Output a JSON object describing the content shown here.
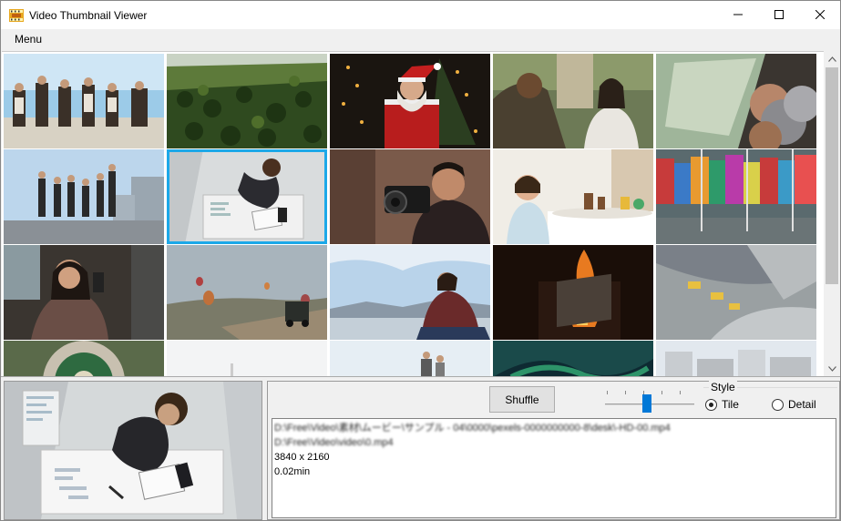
{
  "window": {
    "title": "Video Thumbnail Viewer",
    "controls": {
      "minimize": "─",
      "maximize": "☐",
      "close": "✕"
    }
  },
  "menu": {
    "label": "Menu"
  },
  "grid": {
    "selected_index": 6,
    "thumbnails": [
      "group-sitting-outdoors",
      "pine-forest-aerial",
      "santa-with-tree",
      "couple-on-street",
      "money-and-coins",
      "group-on-rooftop",
      "man-desk-overhead",
      "photographer-with-camera",
      "child-playing-table",
      "shipping-containers-port",
      "woman-in-car-phone",
      "hot-air-balloons-jeep",
      "person-sitting-mountains",
      "fireplace-flames",
      "quarry-trucks-aerial",
      "roundabout-aerial",
      "white-sky",
      "people-on-beach",
      "northern-lights",
      "city-buildings"
    ]
  },
  "toolbar": {
    "shuffle_label": "Shuffle",
    "slider_value_fraction": 0.47
  },
  "style_group": {
    "legend": "Style",
    "options": [
      {
        "label": "Tile",
        "selected": true
      },
      {
        "label": "Detail",
        "selected": false
      }
    ]
  },
  "info": {
    "path_full": "D:\\Free\\Video\\素材\\ムービー\\サンプル - 04\\0000\\pexels-0000000000-8\\desk\\-HD-00.mp4",
    "path_file": "D:\\Free\\Video\\video\\0.mp4",
    "resolution": "3840 x 2160",
    "duration": "0.02min"
  },
  "colors": {
    "selection_border": "#1ca8e8",
    "slider_knob": "#0078d7"
  }
}
